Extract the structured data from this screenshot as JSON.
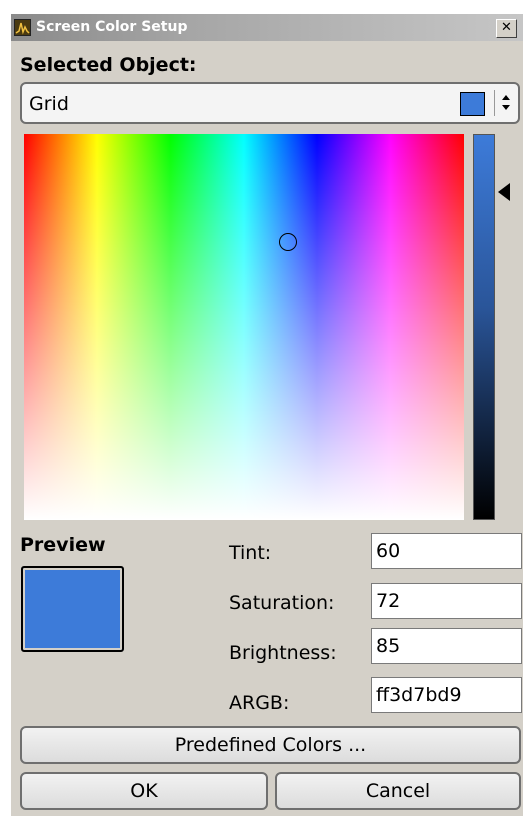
{
  "window": {
    "title": "Screen Color Setup",
    "close_glyph": "✕"
  },
  "selected_object": {
    "label": "Selected Object:",
    "value": "Grid",
    "arrows_glyph": "▴▾"
  },
  "colors": {
    "current": "#3d7bd9"
  },
  "preview": {
    "label": "Preview"
  },
  "fields": {
    "tint": {
      "label": "Tint:",
      "value": "60"
    },
    "saturation": {
      "label": "Saturation:",
      "value": "72"
    },
    "brightness": {
      "label": "Brightness:",
      "value": "85"
    },
    "argb": {
      "label": "ARGB:",
      "value": "ff3d7bd9"
    }
  },
  "buttons": {
    "predefined": "Predefined Colors ...",
    "ok": "OK",
    "cancel": "Cancel"
  },
  "icons": {
    "app": "analyzer-app-icon",
    "close": "close-icon",
    "dropdown": "up-down-arrows-icon",
    "brightness_pointer": "triangle-left-icon"
  }
}
